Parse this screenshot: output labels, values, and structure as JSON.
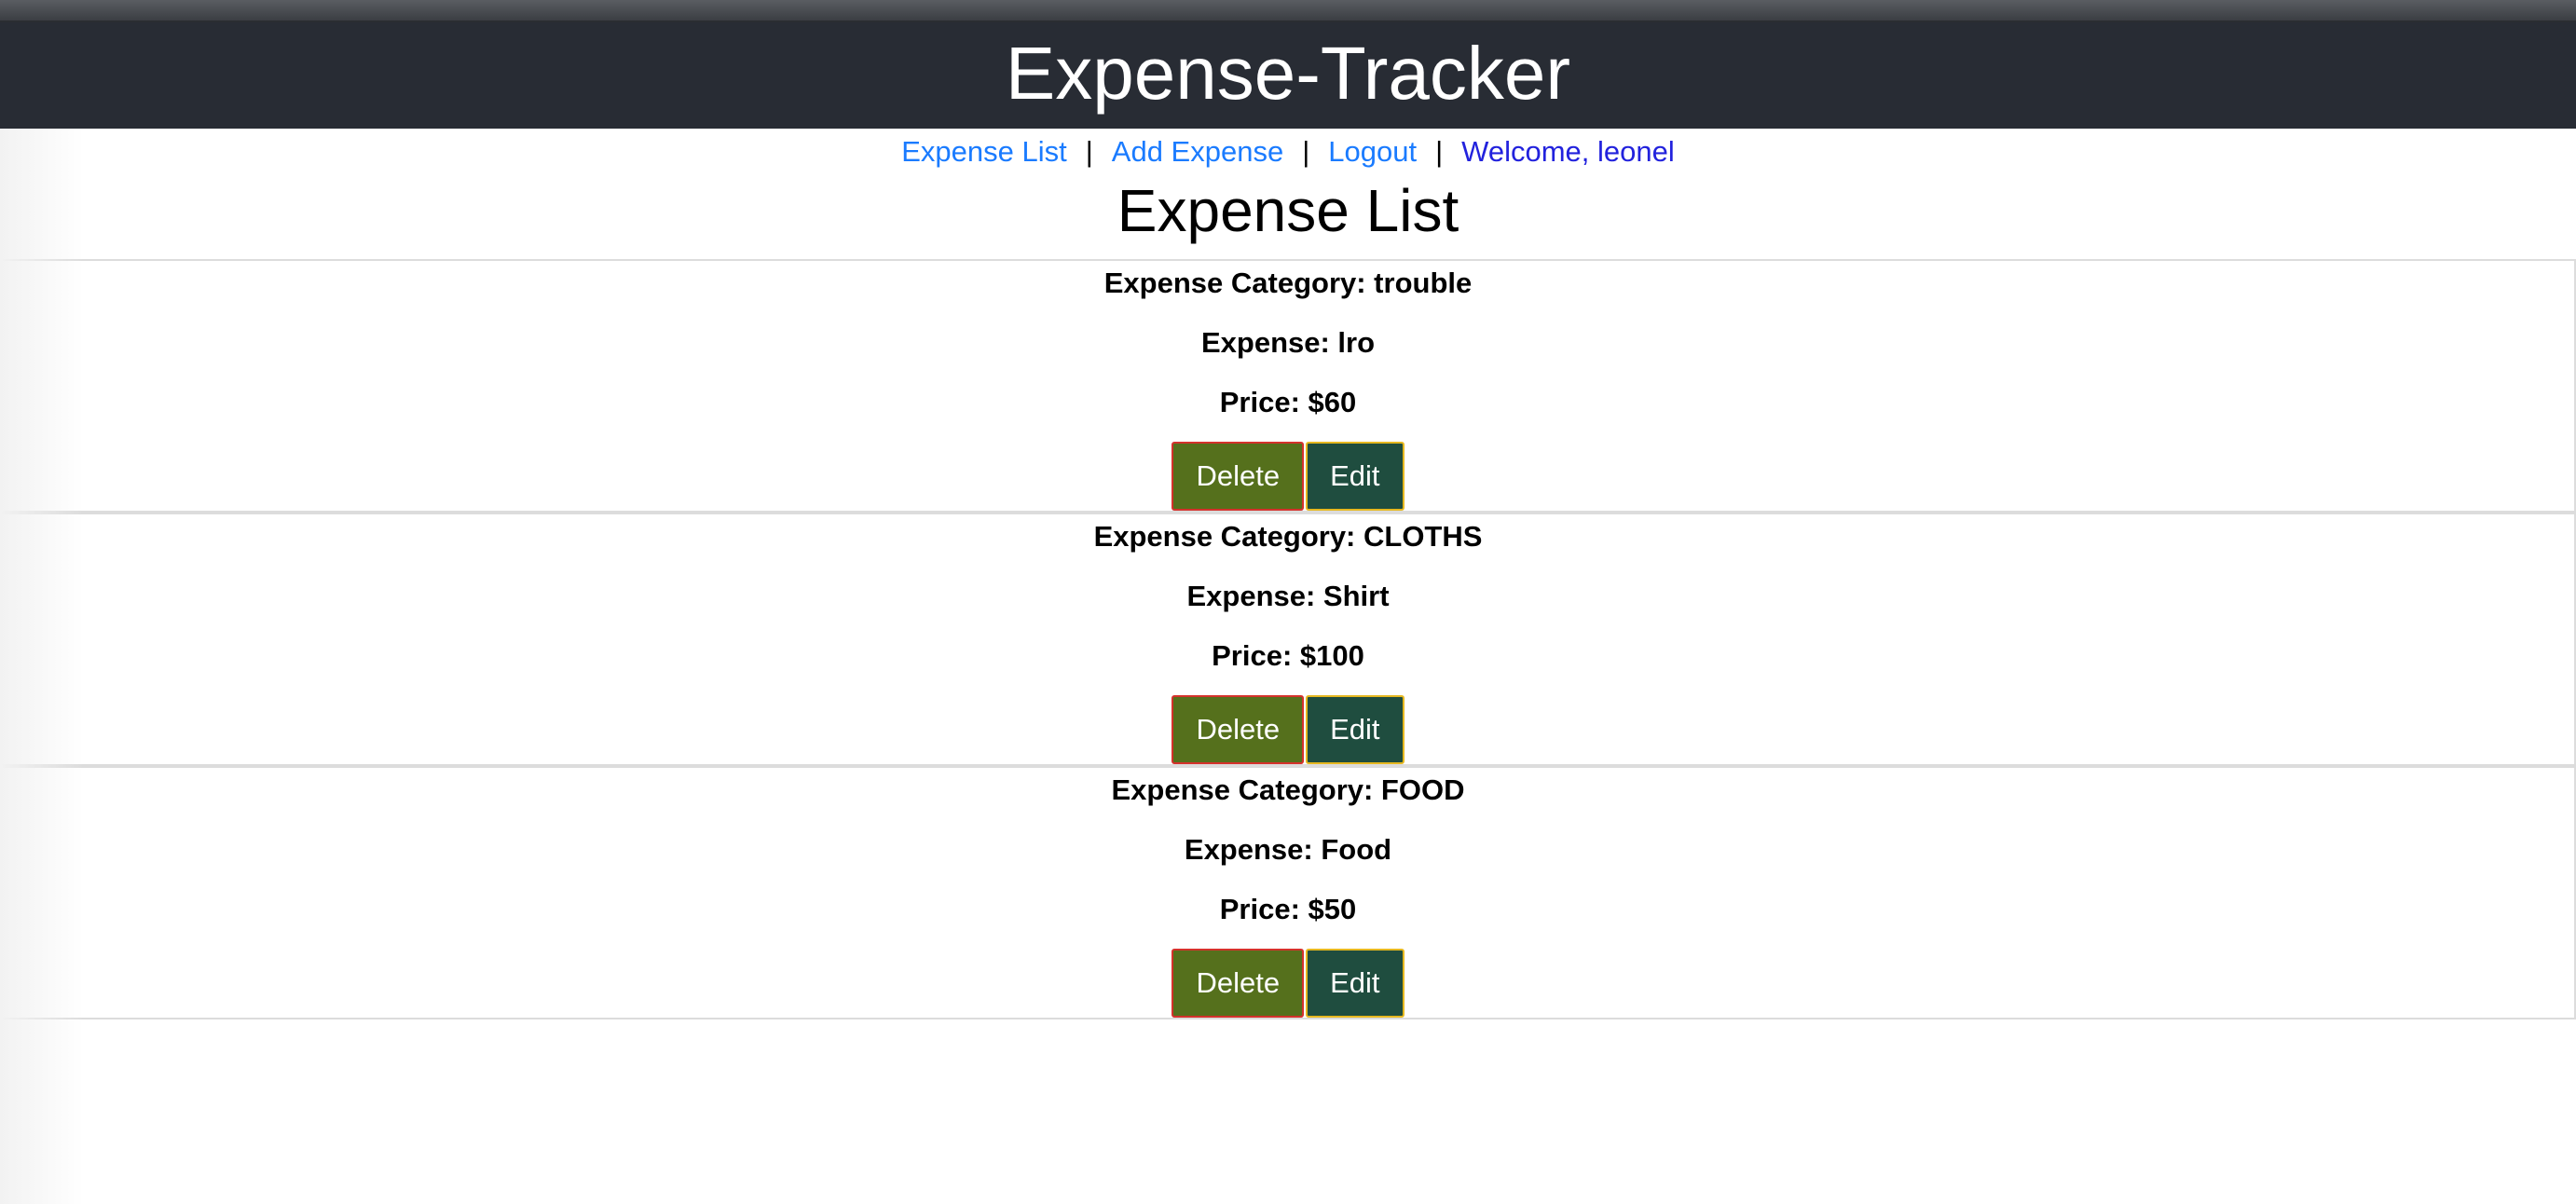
{
  "header": {
    "title": "Expense-Tracker"
  },
  "nav": {
    "expense_list": "Expense List",
    "add_expense": "Add Expense",
    "logout": "Logout",
    "welcome": "Welcome, leonel",
    "separator": "|"
  },
  "page": {
    "title": "Expense List"
  },
  "expenses": [
    {
      "category": "Expense Category: trouble",
      "expense": "Expense: lro",
      "price": "Price: $60",
      "delete_label": "Delete",
      "edit_label": "Edit"
    },
    {
      "category": "Expense Category: CLOTHS",
      "expense": "Expense: Shirt",
      "price": "Price: $100",
      "delete_label": "Delete",
      "edit_label": "Edit"
    },
    {
      "category": "Expense Category: FOOD",
      "expense": "Expense: Food",
      "price": "Price: $50",
      "delete_label": "Delete",
      "edit_label": "Edit"
    }
  ],
  "colors": {
    "header_bg": "#282c34",
    "link": "#1a7bff",
    "welcome": "#2222dd",
    "delete_bg": "#55701c",
    "delete_border": "#d4322c",
    "edit_bg": "#1f4d3f",
    "edit_border": "#e6b820"
  }
}
